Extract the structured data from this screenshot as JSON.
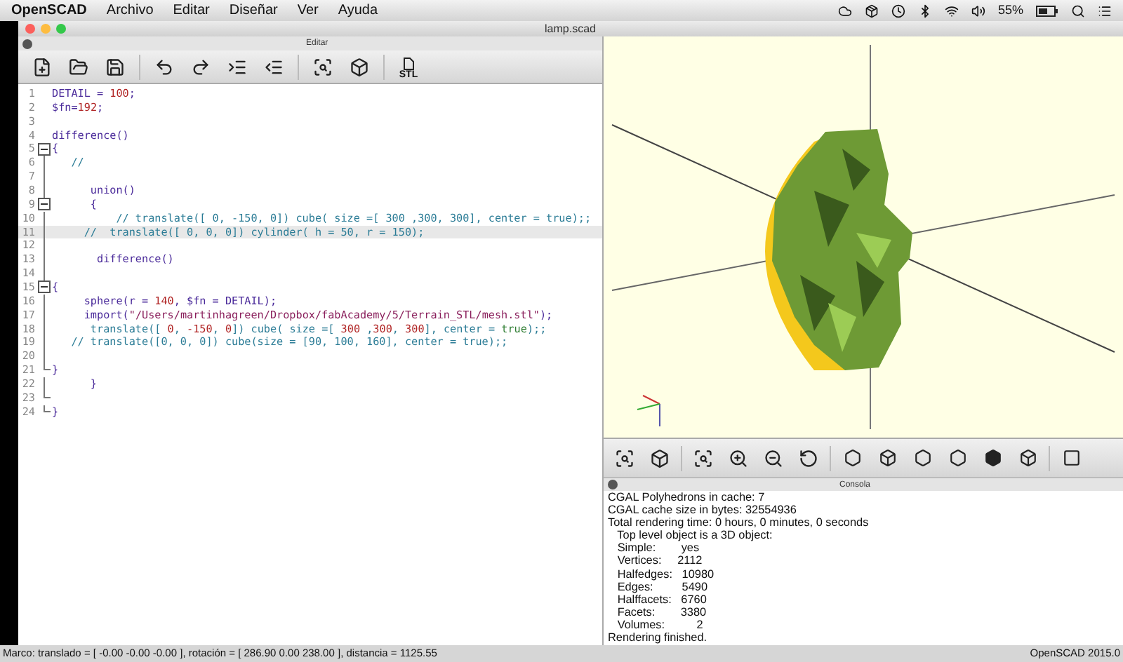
{
  "menu_bar": {
    "app": "OpenSCAD",
    "items": [
      "Archivo",
      "Editar",
      "Diseñar",
      "Ver",
      "Ayuda"
    ],
    "battery_text": "55%"
  },
  "window": {
    "title": "lamp.scad"
  },
  "editor": {
    "title": "Editar",
    "toolbar_stl_label": "STL",
    "lines": [
      {
        "number": "1",
        "kind": "plain",
        "current": false,
        "tokens": [
          {
            "kind": "code",
            "text": "DETAIL = "
          },
          {
            "kind": "number",
            "text": "100"
          },
          {
            "kind": "code",
            "text": ";"
          }
        ]
      },
      {
        "number": "2",
        "kind": "plain",
        "current": false,
        "tokens": [
          {
            "kind": "code",
            "text": "$fn="
          },
          {
            "kind": "number",
            "text": "192"
          },
          {
            "kind": "code",
            "text": ";"
          }
        ]
      },
      {
        "number": "3",
        "kind": "plain",
        "current": false
      },
      {
        "number": "4",
        "kind": "plain",
        "current": false,
        "tokens": [
          {
            "kind": "code",
            "text": "difference()"
          }
        ]
      },
      {
        "number": "5",
        "kind": "foldbox",
        "current": false,
        "tokens": [
          {
            "kind": "code",
            "text": "{"
          }
        ]
      },
      {
        "number": "6",
        "kind": "foldline",
        "current": false,
        "tokens": [
          {
            "kind": "comment",
            "text": "   //"
          }
        ]
      },
      {
        "number": "7",
        "kind": "foldline",
        "current": false
      },
      {
        "number": "8",
        "kind": "foldline",
        "current": false,
        "tokens": [
          {
            "kind": "code",
            "text": "      union()"
          }
        ]
      },
      {
        "number": "9",
        "kind": "foldbox",
        "current": false,
        "tokens": [
          {
            "kind": "code",
            "text": "      {"
          }
        ]
      },
      {
        "number": "10",
        "kind": "foldline",
        "current": false,
        "tokens": [
          {
            "kind": "comment",
            "text": "          // translate([ 0, -150, 0]) cube( size =[ 300 ,300, 300], center = true);;"
          }
        ]
      },
      {
        "number": "11",
        "kind": "foldline",
        "current": true,
        "tokens": [
          {
            "kind": "comment",
            "text": "     //  translate([ 0, 0, 0]) cylinder( h = 50, r = 150);"
          }
        ]
      },
      {
        "number": "12",
        "kind": "foldline",
        "current": false
      },
      {
        "number": "13",
        "kind": "foldline",
        "current": false,
        "tokens": [
          {
            "kind": "code",
            "text": "       difference()"
          }
        ]
      },
      {
        "number": "14",
        "kind": "foldline",
        "current": false
      },
      {
        "number": "15",
        "kind": "foldbox",
        "current": false,
        "tokens": [
          {
            "kind": "code",
            "text": "{"
          }
        ]
      },
      {
        "number": "16",
        "kind": "foldline",
        "current": false,
        "tokens": [
          {
            "kind": "code",
            "text": "     sphere(r = "
          },
          {
            "kind": "number",
            "text": "140"
          },
          {
            "kind": "code",
            "text": ", $fn = DETAIL);"
          }
        ]
      },
      {
        "number": "17",
        "kind": "foldline",
        "current": false,
        "tokens": [
          {
            "kind": "code",
            "text": "     import("
          },
          {
            "kind": "string",
            "text": "\"/Users/martinhagreen/Dropbox/fabAcademy/5/Terrain_STL/mesh.stl\""
          },
          {
            "kind": "code",
            "text": ");"
          }
        ]
      },
      {
        "number": "18",
        "kind": "foldline",
        "current": false,
        "tokens": [
          {
            "kind": "transform",
            "text": "      translate([ "
          },
          {
            "kind": "number",
            "text": "0"
          },
          {
            "kind": "transform",
            "text": ", "
          },
          {
            "kind": "number",
            "text": "-150"
          },
          {
            "kind": "transform",
            "text": ", "
          },
          {
            "kind": "number",
            "text": "0"
          },
          {
            "kind": "transform",
            "text": "]) cube( size =[ "
          },
          {
            "kind": "number",
            "text": "300"
          },
          {
            "kind": "transform",
            "text": " ,"
          },
          {
            "kind": "number",
            "text": "300"
          },
          {
            "kind": "transform",
            "text": ", "
          },
          {
            "kind": "number",
            "text": "300"
          },
          {
            "kind": "transform",
            "text": "], center = "
          },
          {
            "kind": "bool",
            "text": "true"
          },
          {
            "kind": "transform",
            "text": ");;"
          }
        ]
      },
      {
        "number": "19",
        "kind": "foldline",
        "current": false,
        "tokens": [
          {
            "kind": "comment",
            "text": "   // translate([0, 0, 0]) cube(size = [90, 100, 160], center = true);;"
          }
        ]
      },
      {
        "number": "20",
        "kind": "foldline",
        "current": false
      },
      {
        "number": "21",
        "kind": "foldend",
        "current": false,
        "tokens": [
          {
            "kind": "code",
            "text": "}"
          }
        ]
      },
      {
        "number": "22",
        "kind": "foldline",
        "current": false,
        "tokens": [
          {
            "kind": "code",
            "text": "      }"
          }
        ]
      },
      {
        "number": "23",
        "kind": "foldend",
        "current": false
      },
      {
        "number": "24",
        "kind": "foldend",
        "current": false,
        "tokens": [
          {
            "kind": "code",
            "text": "}"
          }
        ]
      }
    ]
  },
  "console": {
    "title": "Consola",
    "lines": [
      "CGAL Polyhedrons in cache: 7",
      "CGAL cache size in bytes: 32554936",
      "Total rendering time: 0 hours, 0 minutes, 0 seconds",
      "   Top level object is a 3D object:",
      "   Simple:        yes",
      "   Vertices:     2112",
      "   Halfedges:   10980",
      "   Edges:         5490",
      "   Halffacets:   6760",
      "   Facets:        3380",
      "   Volumes:          2",
      "Rendering finished."
    ]
  },
  "status_bar": {
    "left": "Marco: translado = [ -0.00 -0.00 -0.00 ], rotación = [ 286.90 0.00 238.00 ], distancia = 1125.55",
    "right": "OpenSCAD 2015.0"
  }
}
